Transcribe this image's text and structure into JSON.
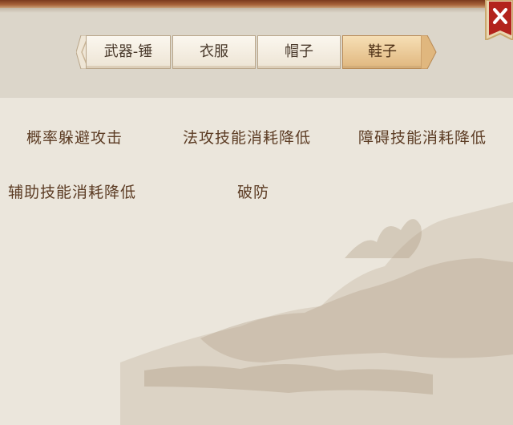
{
  "tabs": [
    {
      "label": "武器-锤",
      "selected": false
    },
    {
      "label": "衣服",
      "selected": false
    },
    {
      "label": "帽子",
      "selected": false
    },
    {
      "label": "鞋子",
      "selected": true
    }
  ],
  "stats": [
    "概率躲避攻击",
    "法攻技能消耗降低",
    "障碍技能消耗降低",
    "辅助技能消耗降低",
    "破防"
  ],
  "close_icon": "close-icon",
  "colors": {
    "selected_tab": "#e6c08a",
    "text": "#5c3c24",
    "close_red": "#b3231c"
  }
}
